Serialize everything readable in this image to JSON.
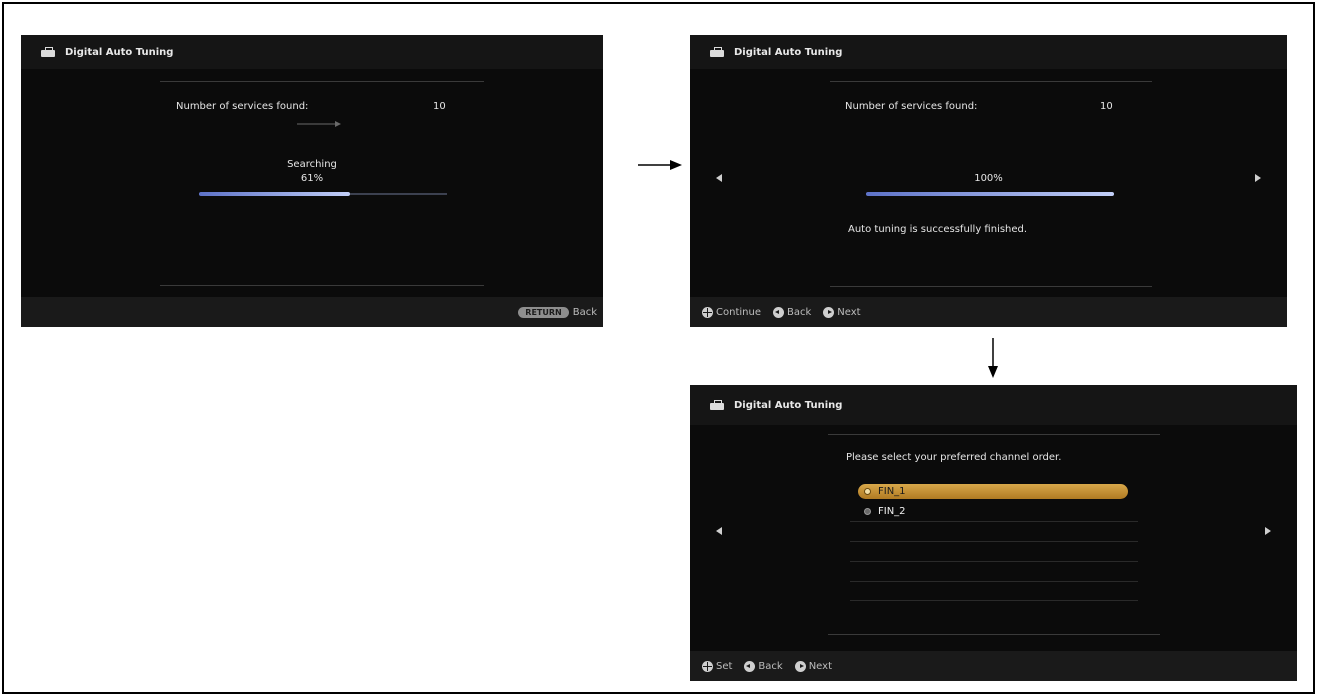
{
  "screens": [
    {
      "header_title": "Digital Auto Tuning",
      "services_label": "Number of services found:",
      "services_count": "10",
      "status_label": "Searching",
      "progress_text": "61%",
      "progress_value": 0.61,
      "footer": {
        "return_key": "RETURN",
        "back_label": "Back"
      }
    },
    {
      "header_title": "Digital Auto Tuning",
      "services_label": "Number of services found:",
      "services_count": "10",
      "progress_text": "100%",
      "progress_value": 1.0,
      "message": "Auto tuning is successfully finished.",
      "footer": {
        "continue_label": "Continue",
        "back_label": "Back",
        "next_label": "Next"
      }
    },
    {
      "header_title": "Digital Auto Tuning",
      "prompt": "Please select your preferred channel order.",
      "options": [
        {
          "label": "FIN_1",
          "selected": true
        },
        {
          "label": "FIN_2",
          "selected": false
        }
      ],
      "footer": {
        "set_label": "Set",
        "back_label": "Back",
        "next_label": "Next"
      }
    }
  ],
  "colors": {
    "screen_bg": "#0b0b0b",
    "header_bg": "#151515",
    "footer_bg": "#1a1a1a",
    "progress_accent": "#5d72c8",
    "selection_accent": "#d8a84a"
  }
}
